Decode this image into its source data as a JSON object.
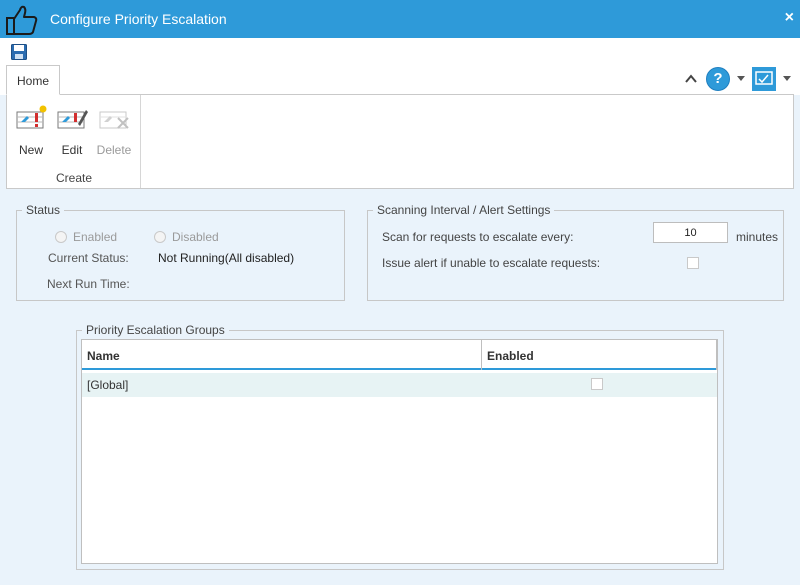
{
  "window": {
    "title": "Configure Priority Escalation",
    "close_glyph": "×"
  },
  "icons": {
    "app": "thumbs-up-icon",
    "save": "save-icon",
    "collapse": "chevron-up-icon",
    "help": "help-icon",
    "layout": "layout-icon",
    "accent": "#2e9ad9"
  },
  "ribbon": {
    "tab_home": "Home",
    "buttons": {
      "new": "New",
      "edit": "Edit",
      "delete": "Delete"
    },
    "group_create": "Create",
    "help_glyph": "?"
  },
  "status": {
    "legend": "Status",
    "enabled_label": "Enabled",
    "disabled_label": "Disabled",
    "current_status_label": "Current Status:",
    "current_status_value": "Not Running(All disabled)",
    "next_run_label": "Next Run Time:"
  },
  "scan": {
    "legend": "Scanning Interval / Alert Settings",
    "interval_label": "Scan for requests to escalate every:",
    "interval_value": "10",
    "interval_unit": "minutes",
    "alert_label": "Issue alert if unable to escalate requests:",
    "alert_checked": false
  },
  "groups": {
    "legend": "Priority Escalation Groups",
    "columns": {
      "name": "Name",
      "enabled": "Enabled"
    },
    "rows": [
      {
        "name": "[Global]",
        "enabled": false
      }
    ]
  }
}
